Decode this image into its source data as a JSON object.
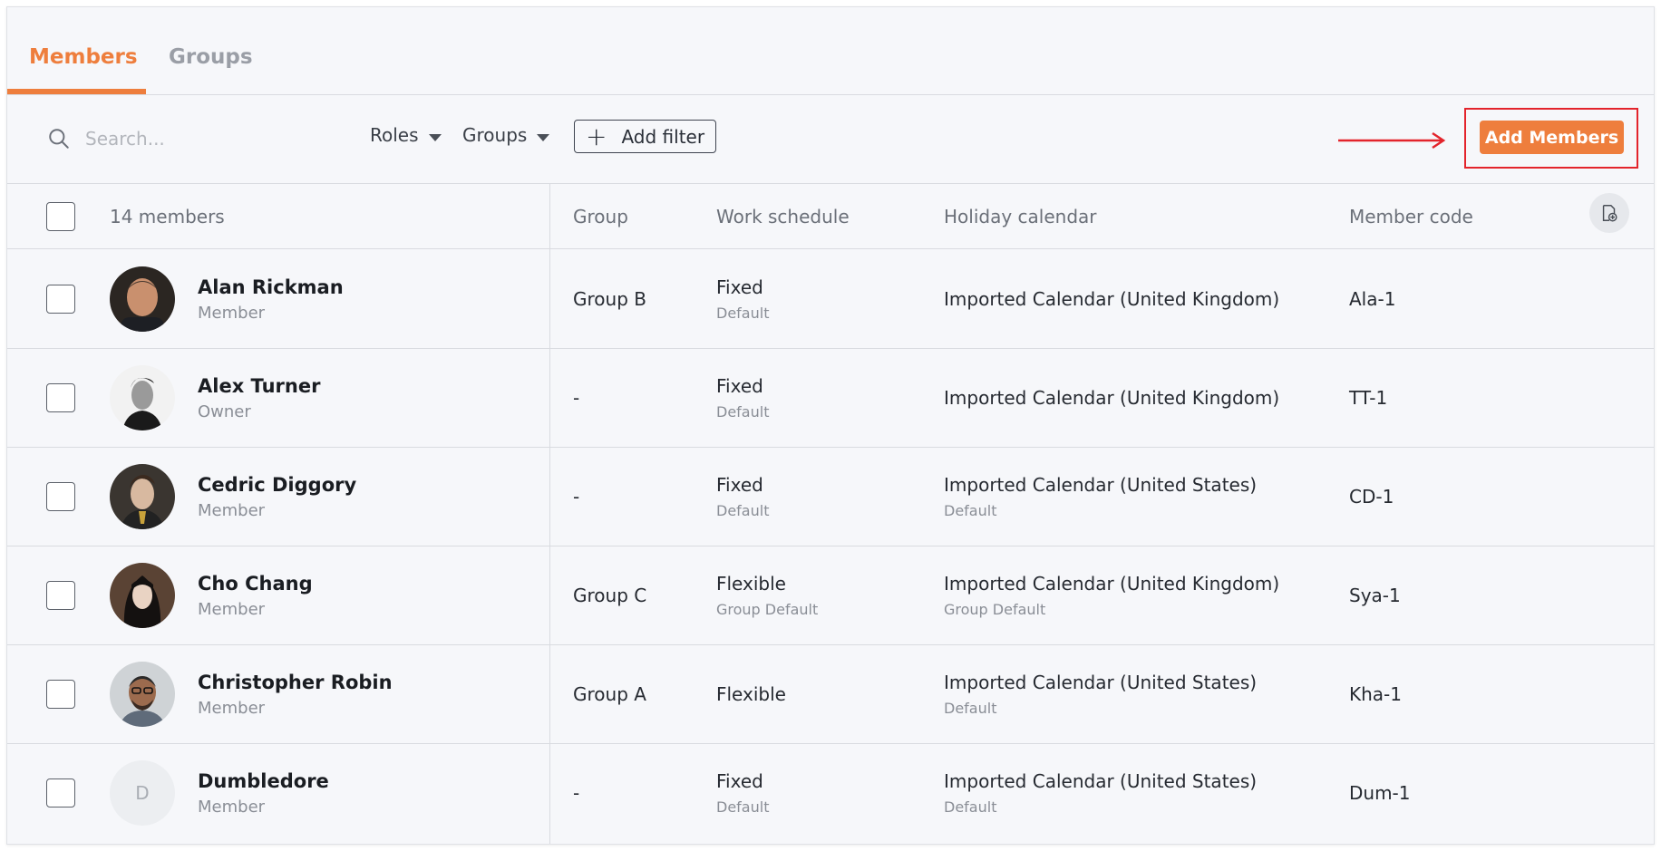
{
  "tabs": [
    {
      "label": "Members",
      "active": true
    },
    {
      "label": "Groups",
      "active": false
    }
  ],
  "toolbar": {
    "search_placeholder": "Search...",
    "roles_label": "Roles",
    "groups_label": "Groups",
    "add_filter_label": "Add filter",
    "add_members_label": "Add Members"
  },
  "table": {
    "member_count": "14 members",
    "headers": {
      "group": "Group",
      "work_schedule": "Work schedule",
      "holiday_calendar": "Holiday calendar",
      "member_code": "Member code"
    },
    "rows": [
      {
        "name": "Alan Rickman",
        "role": "Member",
        "group": "Group B",
        "schedule": "Fixed",
        "schedule_sub": "Default",
        "calendar": "Imported Calendar (United Kingdom)",
        "calendar_sub": "",
        "code": "Ala-1",
        "avatar": "photo"
      },
      {
        "name": "Alex Turner",
        "role": "Owner",
        "group": "-",
        "schedule": "Fixed",
        "schedule_sub": "Default",
        "calendar": "Imported Calendar (United Kingdom)",
        "calendar_sub": "",
        "code": "TT-1",
        "avatar": "photo"
      },
      {
        "name": "Cedric Diggory",
        "role": "Member",
        "group": "-",
        "schedule": "Fixed",
        "schedule_sub": "Default",
        "calendar": "Imported Calendar (United States)",
        "calendar_sub": "Default",
        "code": "CD-1",
        "avatar": "photo"
      },
      {
        "name": "Cho Chang",
        "role": "Member",
        "group": "Group C",
        "schedule": "Flexible",
        "schedule_sub": "Group Default",
        "calendar": "Imported Calendar (United Kingdom)",
        "calendar_sub": "Group Default",
        "code": "Sya-1",
        "avatar": "photo"
      },
      {
        "name": "Christopher Robin",
        "role": "Member",
        "group": "Group A",
        "schedule": "Flexible",
        "schedule_sub": "",
        "calendar": "Imported Calendar (United States)",
        "calendar_sub": "Default",
        "code": "Kha-1",
        "avatar": "photo"
      },
      {
        "name": "Dumbledore",
        "role": "Member",
        "group": "-",
        "schedule": "Fixed",
        "schedule_sub": "Default",
        "calendar": "Imported Calendar (United States)",
        "calendar_sub": "Default",
        "code": "Dum-1",
        "avatar": "D"
      }
    ]
  },
  "colors": {
    "accent": "#ee7e3d",
    "highlight": "#e3242b",
    "background": "#f6f7fa"
  },
  "icons": {
    "search": "search-icon",
    "caret": "caret-down-icon",
    "plus": "plus-icon",
    "column_settings": "column-settings-icon",
    "arrow": "arrow-right-annotation"
  }
}
